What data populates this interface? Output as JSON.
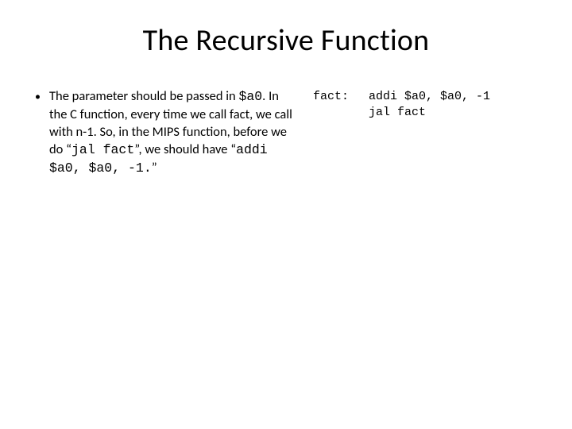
{
  "title": "The Recursive Function",
  "bullet": {
    "marker": "•",
    "seg1": "The parameter should be passed in ",
    "code1": "$a0",
    "seg2": ". In the C function, every time we call fact, we call with n-1. So, in the MIPS function, before we do “",
    "code2": "jal fact",
    "seg3": "”, we should have “",
    "code3": "addi $a0, $a0, -1.",
    "seg4": "”"
  },
  "code": {
    "label": "fact:",
    "line1": "addi $a0, $a0, -1",
    "line2": "jal fact"
  }
}
